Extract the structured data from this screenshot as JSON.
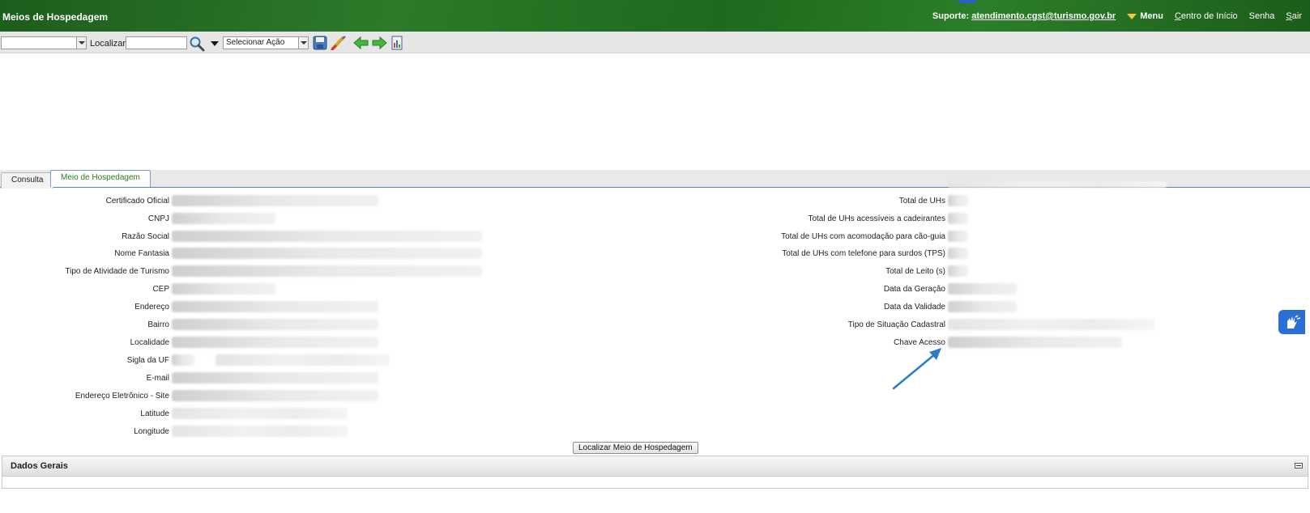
{
  "header": {
    "title": "Meios de Hospedagem",
    "support_label": "Suporte:",
    "support_email": "atendimento.cgst@turismo.gov.br",
    "menu_label": "Menu",
    "start_center_prefix": "C",
    "start_center_rest": "entro de Início",
    "password_label": "Senha",
    "exit_prefix": "S",
    "exit_rest": "air"
  },
  "toolbar": {
    "locate_label": "Localizar:",
    "action_select_value": "Selecionar Ação"
  },
  "tabs": [
    {
      "label": "Consulta"
    },
    {
      "label": "Meio de Hospedagem"
    }
  ],
  "left_fields": [
    {
      "label": "Certificado Oficial"
    },
    {
      "label": "CNPJ"
    },
    {
      "label": "Razão Social"
    },
    {
      "label": "Nome Fantasia"
    },
    {
      "label": "Tipo de Atividade de Turismo"
    },
    {
      "label": "CEP"
    },
    {
      "label": "Endereço"
    },
    {
      "label": "Bairro"
    },
    {
      "label": "Localidade"
    },
    {
      "label": "Sigla da UF"
    },
    {
      "label": "E-mail"
    },
    {
      "label": "Endereço Eletrônico - Site"
    },
    {
      "label": "Latitude"
    },
    {
      "label": "Longitude"
    }
  ],
  "right_fields": [
    {
      "label": "Total de UHs"
    },
    {
      "label": "Total de UHs acessíveis a cadeirantes"
    },
    {
      "label": "Total de UHs com acomodação para cão-guia"
    },
    {
      "label": "Total de UHs com telefone para surdos (TPS)"
    },
    {
      "label": "Total de Leito (s)"
    },
    {
      "label": "Data da Geração"
    },
    {
      "label": "Data da Validade"
    },
    {
      "label": "Tipo de Situação Cadastral"
    },
    {
      "label": "Chave Acesso"
    }
  ],
  "locate_button": "Localizar Meio de Hospedagem",
  "panel": {
    "title": "Dados Gerais"
  },
  "colors": {
    "header_green": "#2d7a2a",
    "active_tab_text": "#2a7a22",
    "annotation_arrow": "#2a7bc8",
    "accessibility_blue": "#2a6fd6"
  }
}
